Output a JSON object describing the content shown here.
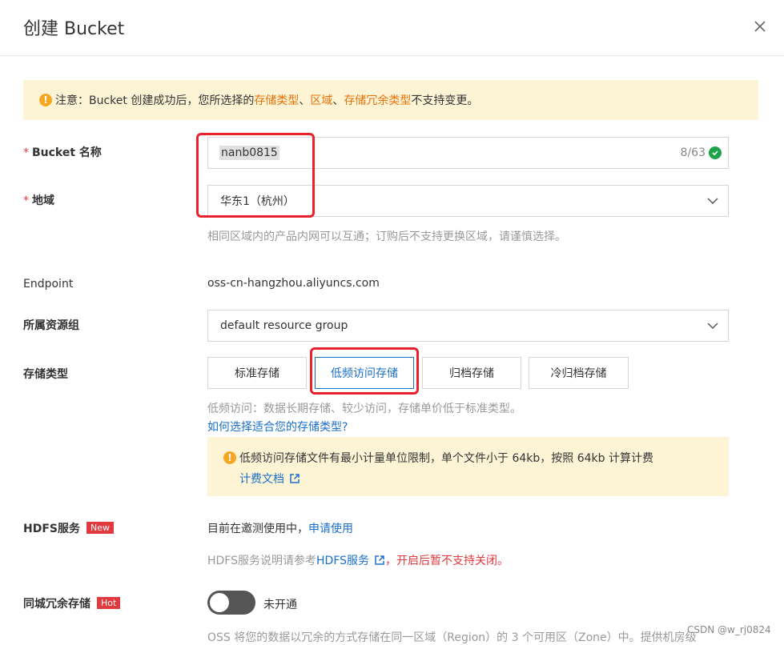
{
  "dialog": {
    "title": "创建 Bucket"
  },
  "notice": {
    "prefix": "注意：Bucket 创建成功后，您所选择的 ",
    "link1": "存储类型",
    "sep1": "、",
    "link2": "区域",
    "sep2": "、",
    "link3": "存储冗余类型",
    "suffix": " 不支持变更。"
  },
  "bucket_name": {
    "label": "Bucket 名称",
    "value": "nanb0815",
    "counter": "8/63"
  },
  "region": {
    "label": "地域",
    "value": "华东1（杭州）",
    "hint": "相同区域内的产品内网可以互通；订购后不支持更换区域，请谨慎选择。"
  },
  "endpoint": {
    "label": "Endpoint",
    "value": "oss-cn-hangzhou.aliyuncs.com"
  },
  "resource_group": {
    "label": "所属资源组",
    "value": "default resource group"
  },
  "storage_class": {
    "label": "存储类型",
    "options": [
      "标准存储",
      "低频访问存储",
      "归档存储",
      "冷归档存储"
    ],
    "selected": "低频访问存储",
    "hint": "低频访问：数据长期存储、较少访问，存储单价低于标准类型。",
    "help_link": "如何选择适合您的存储类型?",
    "info_text": "低频访问存储文件有最小计量单位限制，单个文件小于 64kb，按照 64kb 计算计费",
    "info_link": "计费文档"
  },
  "hdfs": {
    "label": "HDFS服务",
    "badge": "New",
    "status_text": "目前在邀测使用中，",
    "apply_link": "申请使用",
    "desc_prefix": "HDFS服务说明请参考",
    "desc_link": "HDFS服务",
    "desc_warning": "，开启后暂不支持关闭。"
  },
  "redundancy": {
    "label": "同城冗余存储",
    "badge": "Hot",
    "toggle_text": "未开通",
    "enabled": false,
    "desc": "OSS 将您的数据以冗余的方式存储在同一区域（Region）的 3 个可用区（Zone）中。提供机房级"
  },
  "watermark": "CSDN @w_rj0824",
  "colors": {
    "accent": "#1a6fc9",
    "warning_bg": "#fdf4d6",
    "orange": "#e8710a",
    "required": "#e0393e",
    "success": "#1ea34b"
  }
}
